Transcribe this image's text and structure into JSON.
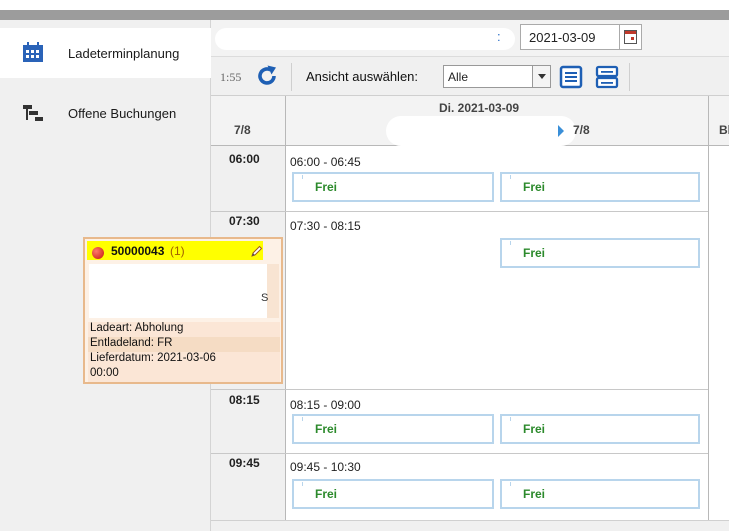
{
  "sidebar": {
    "items": [
      {
        "label": "Ladeterminplanung",
        "icon": "calendar-grid-icon",
        "active": true
      },
      {
        "label": "Offene Buchungen",
        "icon": "stair-list-icon",
        "active": false
      }
    ]
  },
  "header": {
    "colon": ":",
    "date_value": "2021-03-09"
  },
  "toolbar": {
    "time": "1:55",
    "view_label": "Ansicht auswählen:",
    "view_selected": "Alle"
  },
  "grid": {
    "time_header": "7/8",
    "day_header": "Di. 2021-03-09",
    "day_capacity": "7/8",
    "next_col_partial": "Bl",
    "slots": [
      {
        "time": "06:00",
        "range": "06:00 - 06:45",
        "entries": [
          "Frei",
          "Frei"
        ]
      },
      {
        "time": "07:30",
        "range": "07:30 - 08:15",
        "entries": [
          "Frei"
        ]
      },
      {
        "time": "08:15",
        "range": "08:15 - 09:00",
        "entries": [
          "Frei",
          "Frei"
        ]
      },
      {
        "time": "09:45",
        "range": "09:45 - 10:30",
        "entries": [
          "Frei",
          "Frei"
        ]
      }
    ],
    "booking": {
      "number": "50000043",
      "count": "(1)",
      "partial_letter": "S",
      "lines": [
        "Ladeart: Abholung",
        "Entladeland: FR",
        "Lieferdatum: 2021-03-06",
        "00:00"
      ]
    }
  },
  "colors": {
    "free_text": "#2c8a2c",
    "free_border": "#b8d5ec",
    "booking_head": "#ffff00",
    "booking_border": "#e8b98c",
    "accent": "#1e5fb4"
  }
}
